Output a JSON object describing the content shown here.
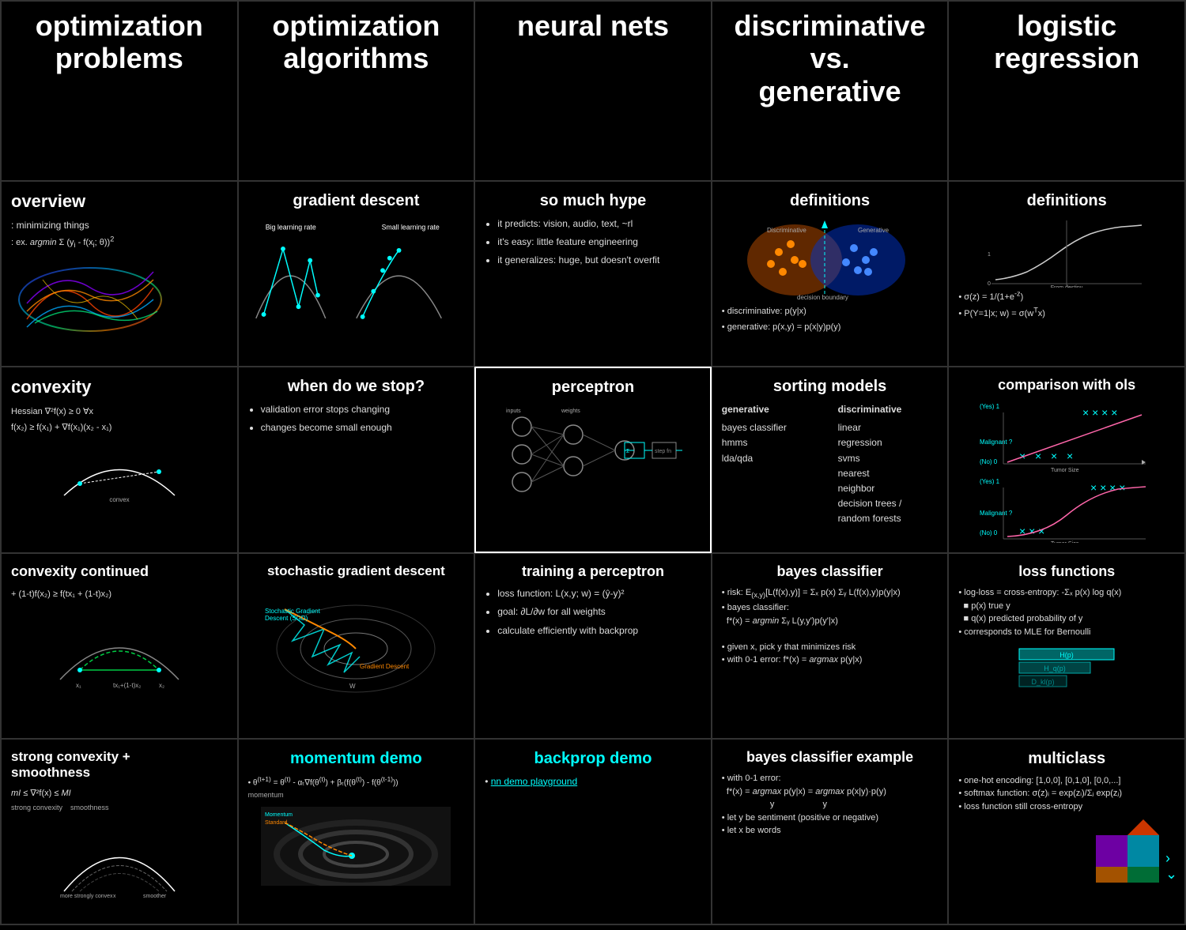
{
  "cells": [
    {
      "id": "r1c1",
      "row": 1,
      "col": 1,
      "title": "optimization\nproblems",
      "type": "big-title"
    },
    {
      "id": "r1c2",
      "row": 1,
      "col": 2,
      "title": "optimization\nalgorithms",
      "type": "big-title"
    },
    {
      "id": "r1c3",
      "row": 1,
      "col": 3,
      "title": "neural nets",
      "type": "big-title"
    },
    {
      "id": "r1c4",
      "row": 1,
      "col": 4,
      "title": "discriminative vs.\ngenerative",
      "type": "big-title"
    },
    {
      "id": "r1c5",
      "row": 1,
      "col": 5,
      "title": "logistic regression",
      "type": "big-title"
    },
    {
      "id": "r2c1",
      "row": 2,
      "col": 1,
      "title": "overview",
      "content": "minimizing things\nex. argmin Σ(yi - f(xi; θ))²",
      "type": "overview"
    },
    {
      "id": "r2c2",
      "row": 2,
      "col": 2,
      "title": "gradient descent",
      "content": "Big learning rate    Small learning rate",
      "type": "gradient-descent"
    },
    {
      "id": "r2c3",
      "row": 2,
      "col": 3,
      "title": "so much hype",
      "bullets": [
        "it predicts: vision, audio, text, ~rl",
        "it's easy: little feature engineering",
        "it generalizes: huge, but doesn't overfit"
      ],
      "type": "bullets"
    },
    {
      "id": "r2c4",
      "row": 2,
      "col": 4,
      "title": "definitions",
      "bullets": [
        "discriminative: p(y|x)",
        "generative: p(x,y) = p(x|y)p(y)"
      ],
      "type": "definitions-disc-gen"
    },
    {
      "id": "r2c5",
      "row": 2,
      "col": 5,
      "title": "definitions",
      "bullets": [
        "σ(z) = 1/(1+e^-z)",
        "P(Y=1|x; w) = σ(wᵀx)"
      ],
      "type": "logistic-def"
    },
    {
      "id": "r3c1",
      "row": 3,
      "col": 1,
      "title": "convexity",
      "content": "Hessian ∇²f(x) ≥ 0 ∀x\nf(x₂) ≥ f(x₁) + ∇f(x₁)(x₂ - x₁)",
      "type": "convexity"
    },
    {
      "id": "r3c2",
      "row": 3,
      "col": 2,
      "title": "when do we stop?",
      "bullets": [
        "validation error stops changing",
        "changes become small enough"
      ],
      "type": "bullets"
    },
    {
      "id": "r3c3",
      "row": 3,
      "col": 3,
      "title": "perceptron",
      "type": "perceptron",
      "highlighted": true
    },
    {
      "id": "r3c4",
      "row": 3,
      "col": 4,
      "title": "sorting models",
      "generative": [
        "bayes classifier",
        "hmms",
        "lda/qda"
      ],
      "discriminative": [
        "linear",
        "regression",
        "svms",
        "nearest neighbor",
        "decision trees /",
        "random forests"
      ],
      "type": "sorting"
    },
    {
      "id": "r3c5",
      "row": 3,
      "col": 5,
      "title": "comparison with ols",
      "type": "comparison-ols"
    },
    {
      "id": "r4c1",
      "row": 4,
      "col": 1,
      "title": "convexity continued",
      "content": "(1-t)f(x₂) ≥ f(tx₁ + (1-t)x₂)",
      "type": "convexity-cont"
    },
    {
      "id": "r4c2",
      "row": 4,
      "col": 2,
      "title": "stochastic gradient descent",
      "type": "sgd"
    },
    {
      "id": "r4c3",
      "row": 4,
      "col": 3,
      "title": "training a perceptron",
      "bullets": [
        "loss function: L(x,y; w) = (yˆ-y)²",
        "goal: ∂L/∂w for all weights",
        "calculate efficiently with backprop"
      ],
      "type": "bullets"
    },
    {
      "id": "r4c4",
      "row": 4,
      "col": 4,
      "title": "bayes classifier",
      "bullets": [
        "risk: E(x,y)[L(f(x),y)] = Σₓ p(x) Σᵧ L(f(x),y)p(y|x)",
        "bayes classifier:",
        "f*(x) = argmin Σᵧ L(y,y')p(y'|x)",
        " ",
        "given x, pick y that minimizes risk",
        "with 0-1 error: f*(x) = argmax p(y|x)"
      ],
      "type": "bayes"
    },
    {
      "id": "r4c5",
      "row": 4,
      "col": 5,
      "title": "loss functions",
      "bullets": [
        "log-loss = cross-entropy: -Σₓ p(x) log q(x)",
        "p(x) true y",
        "q(x) predicted probability of y",
        "corresponds to MLE for Bernoulli"
      ],
      "type": "loss-functions"
    },
    {
      "id": "r5c1",
      "row": 5,
      "col": 1,
      "title": "strong convexity +\nsmoothness",
      "content": "mI ≤ ∇²f(x) ≤ MI\nstrong convexity    smoothness",
      "type": "strong-convexity"
    },
    {
      "id": "r5c2",
      "row": 5,
      "col": 2,
      "title": "momentum demo",
      "subtitle": "• θ^(t+1) = θ^(t) - αₜ∇f(θ^(t)) + βₜ(f(θ^(t)) - f(θ^(t-1)))\nmomentum",
      "type": "momentum"
    },
    {
      "id": "r5c3",
      "row": 5,
      "col": 3,
      "title": "backprop demo",
      "subtitle": "• nn demo playground",
      "type": "backprop-demo"
    },
    {
      "id": "r5c4",
      "row": 5,
      "col": 4,
      "title": "bayes classifier example",
      "bullets": [
        "with 0-1 error:",
        "f*(x) = argmax p(y|x) = argmax p(x|y)·p(y)",
        "let y be sentiment (positive or negative)",
        "let x be words"
      ],
      "type": "bayes-example"
    },
    {
      "id": "r5c5",
      "row": 5,
      "col": 5,
      "title": "multiclass",
      "bullets": [
        "one-hot encoding: [1,0,0], [0,1,0], [0,0,...",
        "softmax function: σ(z)ᵢ = exp(zᵢ)/Σⱼ exp(zⱼ)",
        "loss function still cross-entropy"
      ],
      "type": "multiclass"
    }
  ],
  "nav": {
    "arrow": "›"
  }
}
